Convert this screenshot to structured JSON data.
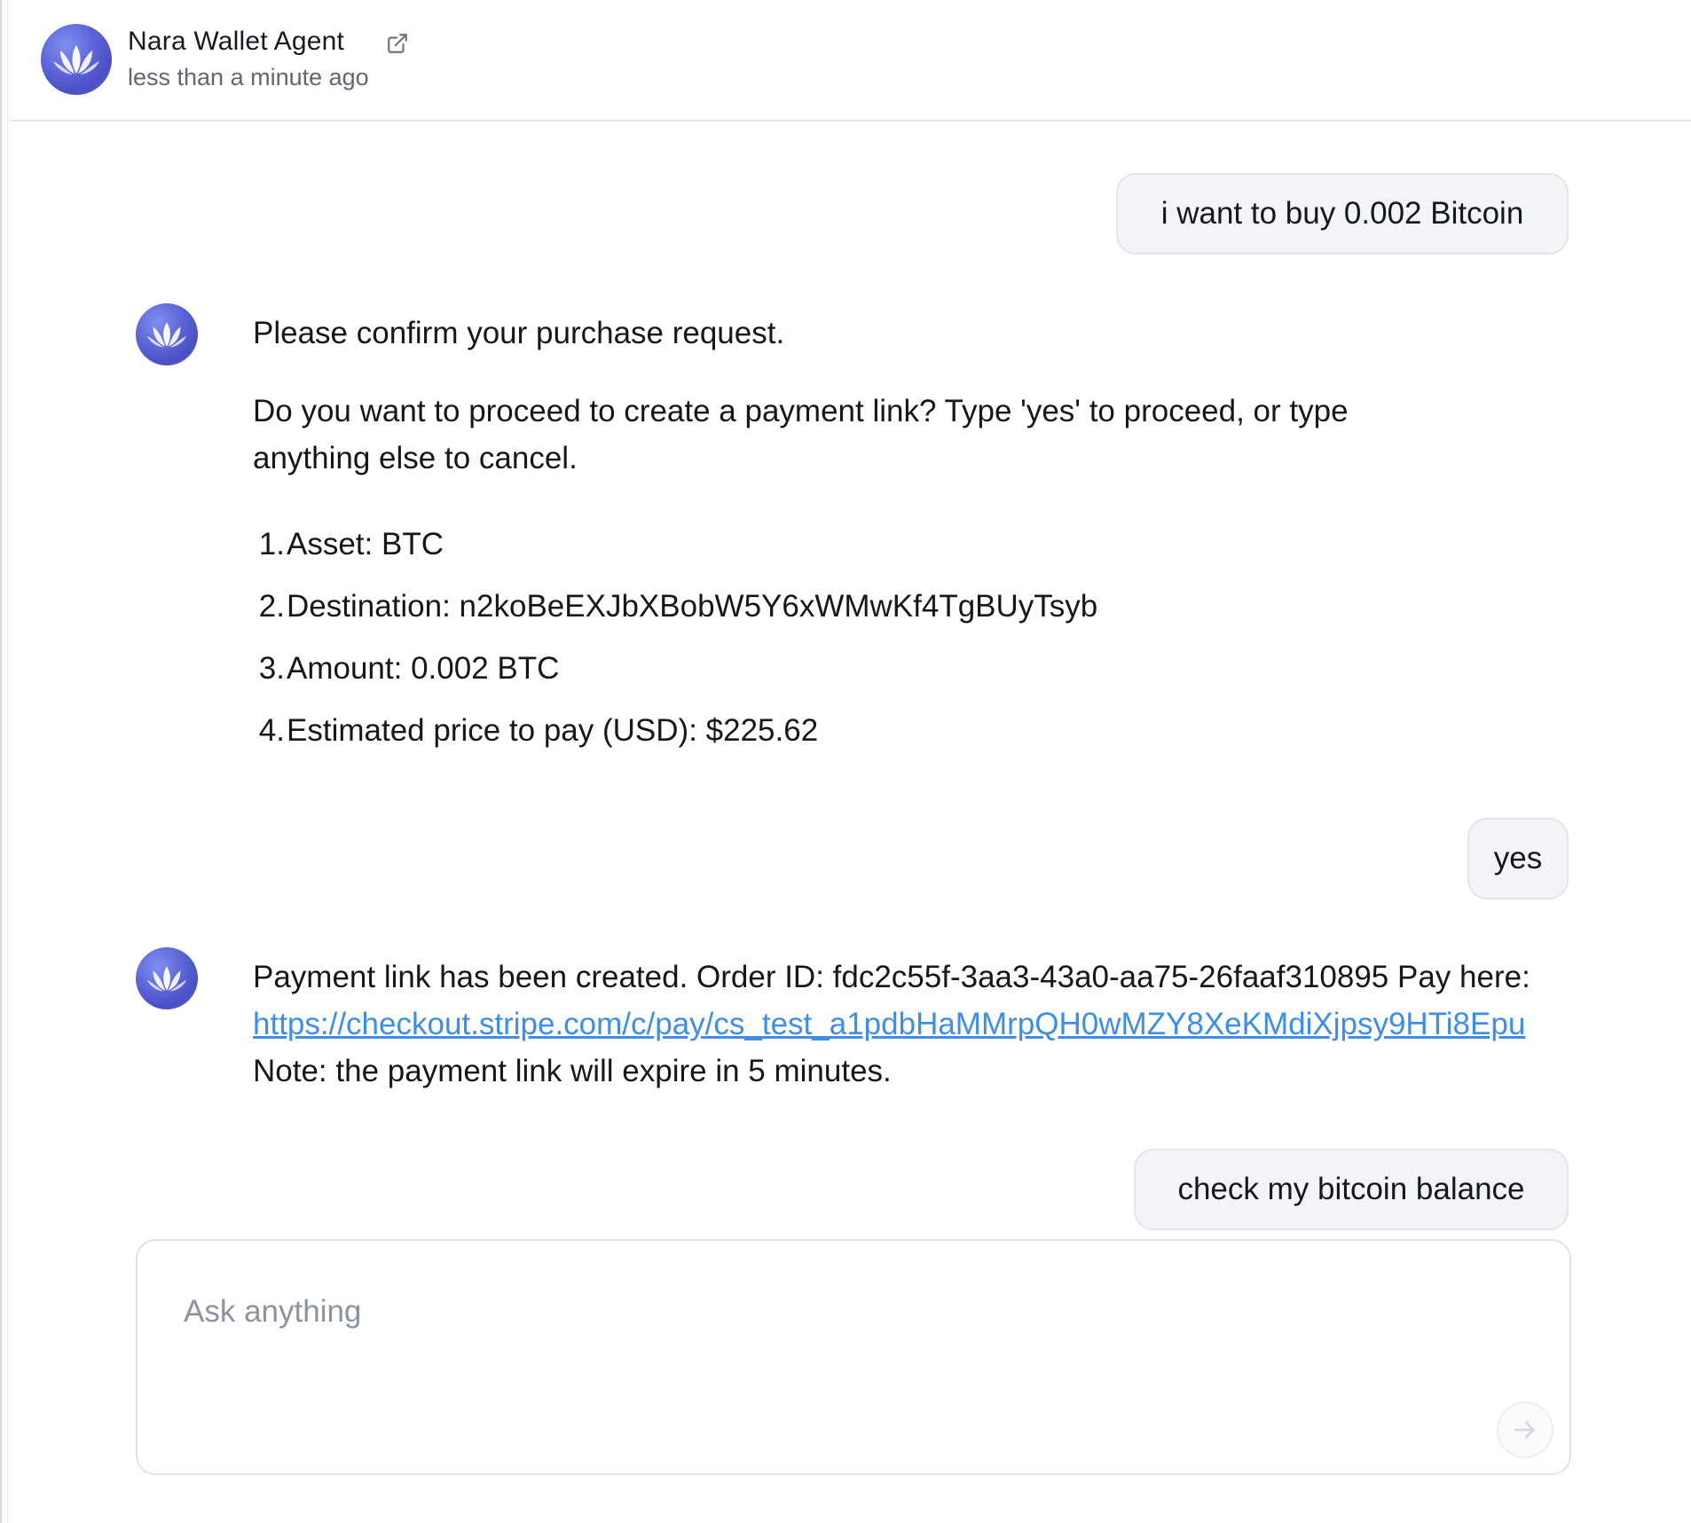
{
  "header": {
    "agent_name": "Nara Wallet Agent",
    "timestamp": "less than a minute ago",
    "external_link_icon": "external-link-icon"
  },
  "messages": [
    {
      "role": "user",
      "text": "i want to buy 0.002 Bitcoin"
    },
    {
      "role": "agent",
      "paragraphs": [
        "Please confirm your purchase request.",
        "Do you want to proceed to create a payment link? Type 'yes' to proceed, or type",
        "anything else to cancel."
      ],
      "list": [
        {
          "num": "1.",
          "text": "Asset: BTC"
        },
        {
          "num": "2.",
          "text": "Destination: n2koBeEXJbXBobW5Y6xWMwKf4TgBUyTsyb"
        },
        {
          "num": "3.",
          "text": "Amount: 0.002 BTC"
        },
        {
          "num": "4.",
          "text": "Estimated price to pay (USD): $225.62"
        }
      ]
    },
    {
      "role": "user",
      "text": "yes"
    },
    {
      "role": "agent",
      "line1": "Payment link has been created. Order ID: fdc2c55f-3aa3-43a0-aa75-26faaf310895 Pay here:",
      "link": "https://checkout.stripe.com/c/pay/cs_test_a1pdbHaMMrpQH0wMZY8XeKMdiXjpsy9HTi8Epu",
      "line3": "Note: the payment link will expire in 5 minutes."
    },
    {
      "role": "user",
      "text": "check my bitcoin balance"
    }
  ],
  "composer": {
    "placeholder": "Ask anything",
    "value": "",
    "send_icon": "arrow-right-icon"
  },
  "colors": {
    "link": "#3e8ee6",
    "bubble_bg": "#f3f4f7",
    "avatar_accent": "#5a63d6"
  }
}
